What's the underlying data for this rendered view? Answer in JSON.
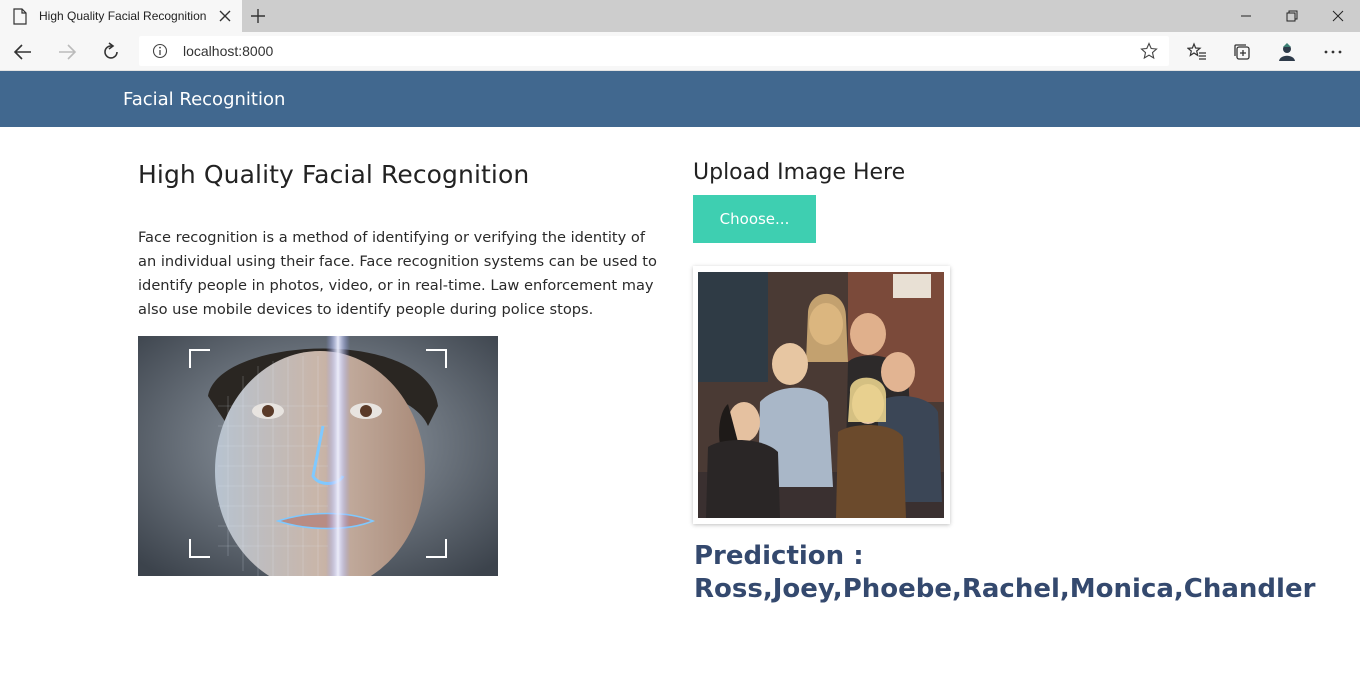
{
  "browser": {
    "tab_title": "High Quality Facial Recognition",
    "url": "localhost:8000"
  },
  "navbar": {
    "brand": "Facial Recognition",
    "background_color": "#41688f"
  },
  "intro": {
    "title": "High Quality Facial Recognition",
    "paragraph": "Face recognition is a method of identifying or verifying the identity of an individual using their face. Face recognition systems can be used to identify people in photos, video, or in real-time. Law enforcement may also use mobile devices to identify people during police stops."
  },
  "upload": {
    "heading": "Upload Image Here",
    "button_label": "Choose...",
    "button_color": "#3ecfb1"
  },
  "prediction": {
    "label": "Prediction :",
    "values": "Ross,Joey,Phoebe,Rachel,Monica,Chandler",
    "text_color": "#34496e"
  },
  "icons": {
    "tab": "page-icon",
    "tab_close": "close-icon",
    "new_tab": "plus-icon",
    "back": "back-arrow-icon",
    "forward": "forward-arrow-icon",
    "refresh": "refresh-icon",
    "site_info": "info-icon",
    "favorite": "star-icon",
    "favorites": "favorites-icon",
    "collections": "collections-icon",
    "profile": "profile-icon",
    "menu": "more-icon"
  }
}
